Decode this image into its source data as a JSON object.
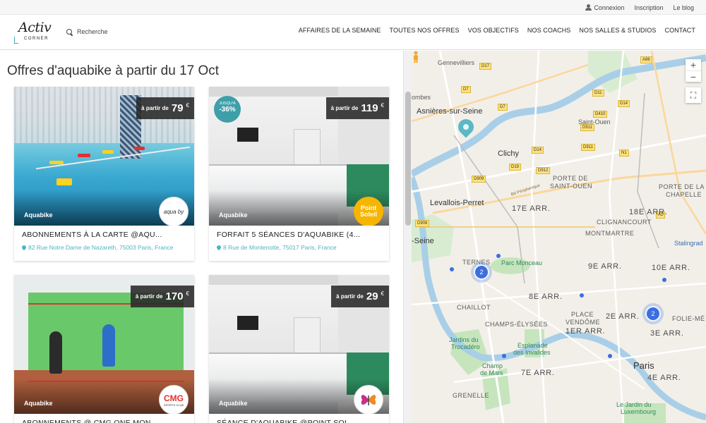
{
  "topbar": {
    "connexion": "Connexion",
    "inscription": "Inscription",
    "blog": "Le blog"
  },
  "header": {
    "logo_script": "Activ",
    "logo_sub": "CORNER",
    "search_label": "Recherche",
    "nav": [
      "AFFAIRES DE LA SEMAINE",
      "TOUTES NOS OFFRES",
      "VOS OBJECTIFS",
      "NOS COACHS",
      "NOS SALLES & STUDIOS",
      "CONTACT"
    ]
  },
  "page": {
    "title": "Offres d'aquabike à partir du 17 Oct"
  },
  "offers": [
    {
      "price_prefix": "à partir de",
      "price": "79",
      "currency": "€",
      "category": "Aquabike",
      "brand": "aqua by",
      "title": "ABONNEMENTS À LA CARTE @AQU...",
      "address": "82 Rue Notre Dame de Nazareth, 75003 Paris, France"
    },
    {
      "price_prefix": "à partir de",
      "price": "119",
      "currency": "€",
      "category": "Aquabike",
      "brand": "Point Soleil",
      "discount_label": "JUSQU'À",
      "discount": "-36%",
      "title": "FORFAIT 5 SÉANCES D'AQUABIKE (4...",
      "address": "8 Rue de Montenotte, 75017 Paris, France"
    },
    {
      "price_prefix": "à partir de",
      "price": "170",
      "currency": "€",
      "category": "Aquabike",
      "brand": "CMG",
      "brand_sub": "SPORTS CLUB",
      "title": "ABONNEMENTS @ CMG ONE MON...",
      "address": ""
    },
    {
      "price_prefix": "à partir de",
      "price": "29",
      "currency": "€",
      "category": "Aquabike",
      "brand": "",
      "title": "SÉANCE D'AQUABIKE @POINT SOL...",
      "address": ""
    }
  ],
  "map": {
    "zoom_in": "+",
    "zoom_out": "−",
    "fullscreen": "⛶",
    "clusters": [
      "2",
      "2"
    ],
    "labels": {
      "gennevilliers": "Gennevilliers",
      "asnieres": "Asnières-sur-Seine",
      "combes": "ombes",
      "saint_ouen": "Saint-Ouen",
      "clichy": "Clichy",
      "porte_st_ouen_1": "PORTE DE",
      "porte_st_ouen_2": "SAINT-OUEN",
      "porte_chapelle_1": "PORTE DE LA",
      "porte_chapelle_2": "CHAPELLE",
      "levallois": "Levallois-Perret",
      "arr17": "17E ARR.",
      "arr18": "18E ARR.",
      "clignancourt": "CLIGNANCOURT",
      "montmartre": "MONTMARTRE",
      "seine": "-Seine",
      "stalingrad": "Stalingrad",
      "ternes": "TERNES",
      "parc_monceau": "Parc Monceau",
      "arr9": "9E ARR.",
      "arr10": "10E ARR.",
      "arr8": "8E ARR.",
      "chaillot": "CHAILLOT",
      "place_vendome_1": "PLACE",
      "place_vendome_2": "VENDÔME",
      "arr2": "2E ARR.",
      "folie": "FOLIE-MÉ",
      "arr3": "3E ARR.",
      "champs": "CHAMPS-ÉLYSÉES",
      "arr1": "1ER ARR.",
      "trocadero_1": "Jardins du",
      "trocadero_2": "Trocadéro",
      "invalides_1": "Esplanade",
      "invalides_2": "des Invalides",
      "champ_mars_1": "Champ",
      "champ_mars_2": "de Mars",
      "arr7": "7E ARR.",
      "paris": "Paris",
      "arr4": "4E ARR.",
      "grenelle": "GRENELLE",
      "luxembourg_1": "Le Jardin du",
      "luxembourg_2": "Luxembourg",
      "bd_peripherique": "Bd Périphérique"
    },
    "road_shields": [
      "D17",
      "D7",
      "D11",
      "A86",
      "D410",
      "D14",
      "D909",
      "D19",
      "D912",
      "D908",
      "D911",
      "D7",
      "A1",
      "N1",
      "D911",
      "D14"
    ]
  },
  "colors": {
    "accent": "#4db5c2",
    "cluster": "#3a6fe0",
    "price_bg": "#282828"
  }
}
